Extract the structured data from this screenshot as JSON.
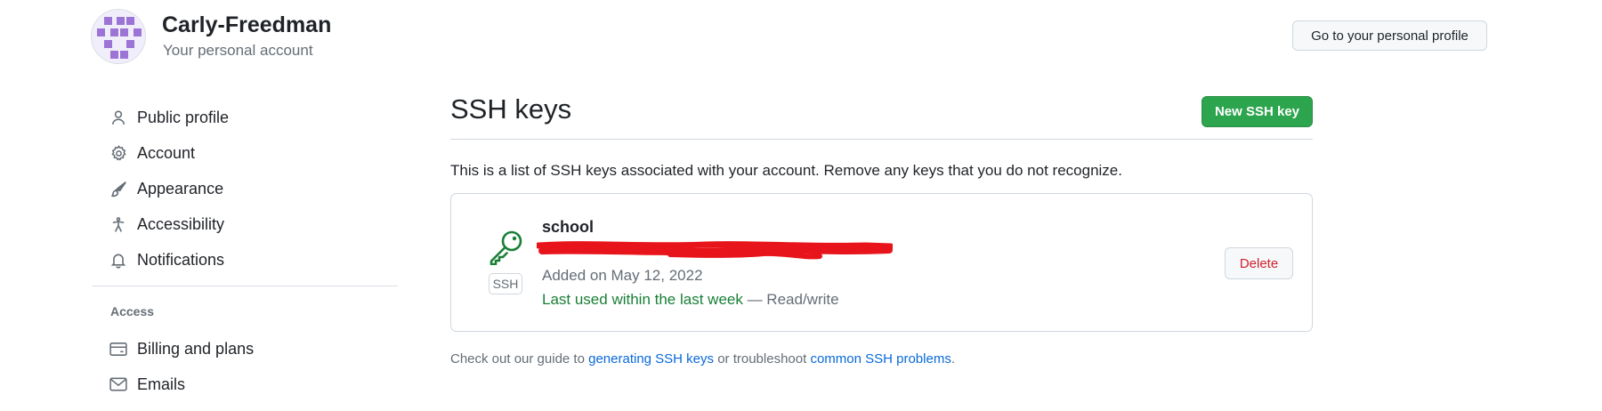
{
  "header": {
    "account_name": "Carly-Freedman",
    "account_subtitle": "Your personal account",
    "profile_button": "Go to your personal profile"
  },
  "sidebar": {
    "items": [
      {
        "label": "Public profile",
        "icon": "person-icon"
      },
      {
        "label": "Account",
        "icon": "gear-icon"
      },
      {
        "label": "Appearance",
        "icon": "paintbrush-icon"
      },
      {
        "label": "Accessibility",
        "icon": "accessibility-icon"
      },
      {
        "label": "Notifications",
        "icon": "bell-icon"
      }
    ],
    "section_title": "Access",
    "access_items": [
      {
        "label": "Billing and plans",
        "icon": "credit-card-icon"
      },
      {
        "label": "Emails",
        "icon": "mail-icon"
      }
    ]
  },
  "main": {
    "title": "SSH keys",
    "new_key_button": "New SSH key",
    "intro": "This is a list of SSH keys associated with your account. Remove any keys that you do not recognize.",
    "key": {
      "name": "school",
      "badge": "SSH",
      "added": "Added on May 12, 2022",
      "last_used": "Last used within the last week",
      "access": " — Read/write",
      "delete_button": "Delete",
      "icon": "key-icon"
    },
    "footer": {
      "prefix": "Check out our guide to ",
      "link1": "generating SSH keys",
      "middle": " or troubleshoot ",
      "link2": "common SSH problems",
      "suffix": "."
    }
  },
  "colors": {
    "primary_button": "#2da44e",
    "link": "#0969da",
    "danger": "#cf222e",
    "success_text": "#1a7f37",
    "redaction": "#e8141b"
  }
}
